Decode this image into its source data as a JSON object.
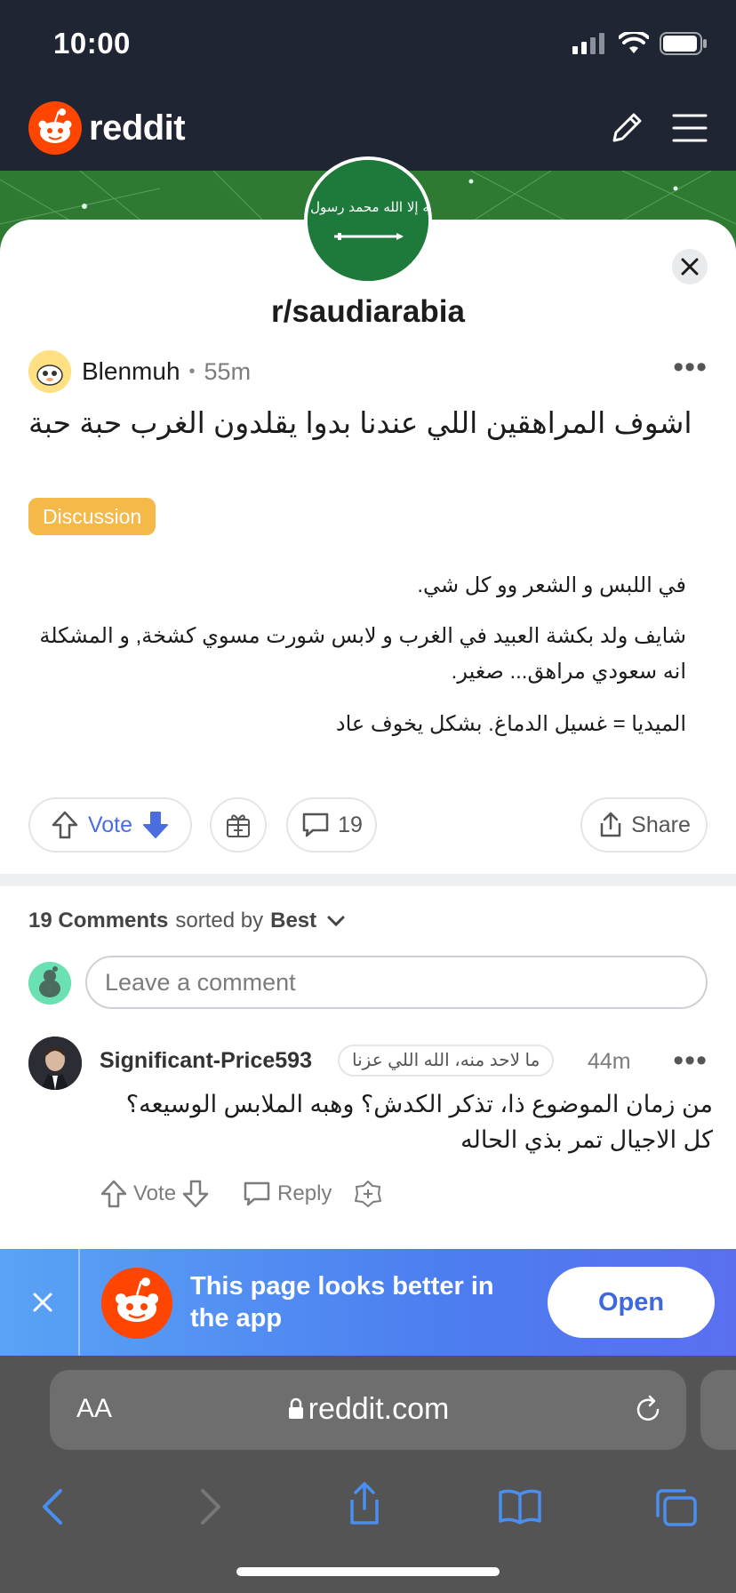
{
  "status_bar": {
    "time": "10:00"
  },
  "header": {
    "brand": "reddit",
    "icons": [
      "pencil-icon",
      "menu-icon"
    ]
  },
  "subreddit": {
    "name": "r/saudiarabia",
    "avatar_text": "لا إله إلا الله محمد رسول الله"
  },
  "post": {
    "author": "Blenmuh",
    "age": "55m",
    "title": "اشوف المراهقين اللي عندنا بدوا يقلدون الغرب حبة حبة",
    "flair": "Discussion",
    "flair_color": "#f5b94a",
    "body": [
      "في اللبس و الشعر وو كل شي.",
      "شايف ولد بكشة العبيد في الغرب و لابس شورت مسوي كشخة, و المشكلة انه سعودي مراهق... صغير.",
      "الميديا = غسيل الدماغ. بشكل يخوف عاد"
    ],
    "vote_label": "Vote",
    "comment_count": "19",
    "share_label": "Share"
  },
  "comments_section": {
    "count_label": "19 Comments",
    "sorted_by_label": "sorted by",
    "sort_value": "Best",
    "input_placeholder": "Leave a comment"
  },
  "comments": [
    {
      "author": "Significant-Price593",
      "flair": "ما لاحد منه، الله اللي عزنا",
      "age": "44m",
      "text": "من زمان الموضوع ذا، تذكر الكدش؟ وهبه الملابس الوسيعه؟ كل الاجيال تمر بذي الحاله",
      "vote_label": "Vote",
      "reply_label": "Reply"
    }
  ],
  "app_banner": {
    "message": "This page looks better in the app",
    "open_label": "Open"
  },
  "safari": {
    "aa_label": "AA",
    "url": "reddit.com"
  },
  "colors": {
    "brand": "#ff4500",
    "header_bg": "#1f2532",
    "vote_accent": "#4a6ee0",
    "banner_blue": "#4c7ef0"
  }
}
